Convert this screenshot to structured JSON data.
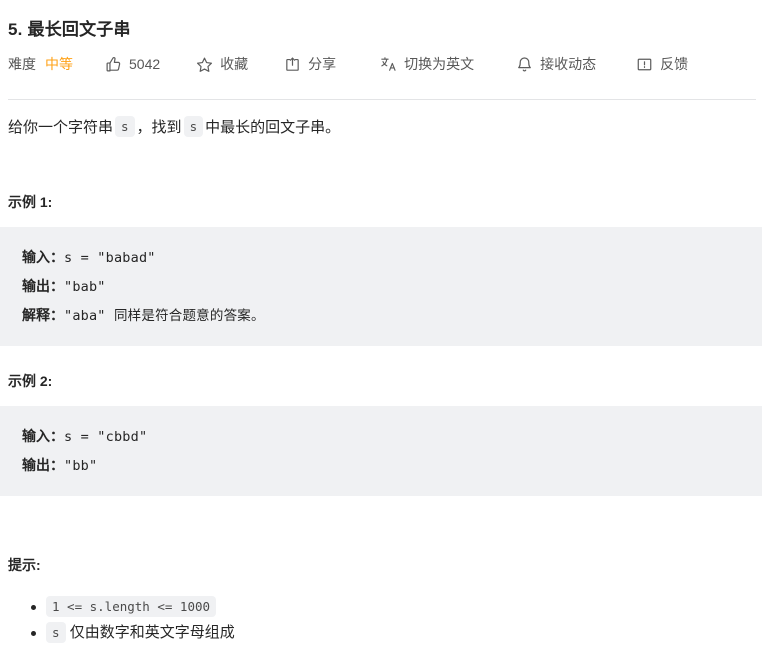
{
  "problem": {
    "title": "5. 最长回文子串",
    "difficulty_label": "难度",
    "difficulty_value": "中等",
    "difficulty_color": "#ffa116"
  },
  "toolbar": {
    "like": {
      "icon": "thumbs-up-icon",
      "count": "5042"
    },
    "favorite": {
      "icon": "star-icon",
      "label": "收藏"
    },
    "share": {
      "icon": "share-icon",
      "label": "分享"
    },
    "language": {
      "icon": "translate-icon",
      "label": "切换为英文"
    },
    "notify": {
      "icon": "bell-icon",
      "label": "接收动态"
    },
    "feedback": {
      "icon": "feedback-icon",
      "label": "反馈"
    }
  },
  "description": {
    "part1": "给你一个字符串",
    "code1": "s",
    "part2": "，找到",
    "code2": "s",
    "part3": "中最长的回文子串。"
  },
  "examples": [
    {
      "heading": "示例 1:",
      "lines": [
        {
          "label": "输入：",
          "value": "s = \"babad\""
        },
        {
          "label": "输出：",
          "value": "\"bab\""
        },
        {
          "label": "解释：",
          "value": "\"aba\" 同样是符合题意的答案。"
        }
      ]
    },
    {
      "heading": "示例 2:",
      "lines": [
        {
          "label": "输入：",
          "value": "s = \"cbbd\""
        },
        {
          "label": "输出：",
          "value": "\"bb\""
        }
      ]
    }
  ],
  "hints": {
    "heading": "提示:",
    "items": [
      {
        "code": "1 <= s.length <= 1000",
        "text": ""
      },
      {
        "code": "s",
        "text": "仅由数字和英文字母组成"
      }
    ]
  }
}
